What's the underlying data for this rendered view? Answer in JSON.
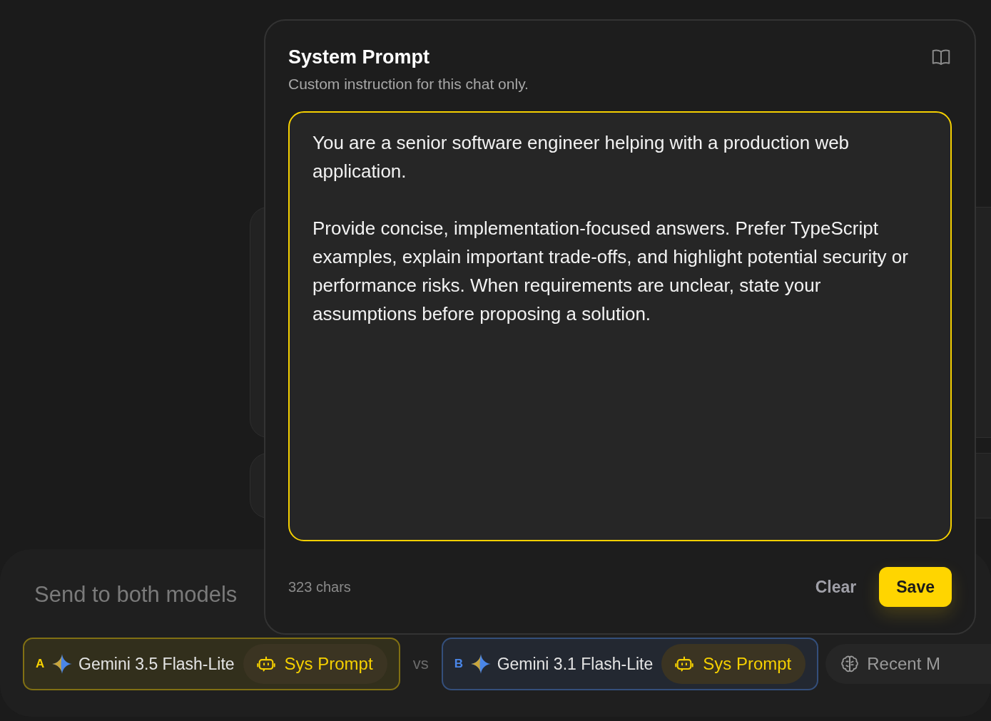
{
  "modal": {
    "title": "System Prompt",
    "subtitle": "Custom instruction for this chat only.",
    "prompt": "You are a senior software engineer helping with a production web application.\n\nProvide concise, implementation-focused answers. Prefer TypeScript examples, explain important trade-offs, and highlight potential security or performance risks. When requirements are unclear, state your assumptions before proposing a solution.",
    "char_count": "323 chars",
    "buttons": [
      {
        "label": "Clear",
        "kind": "secondary"
      },
      {
        "label": "Save",
        "kind": "primary"
      }
    ]
  },
  "composer": {
    "placeholder": "Send to both models",
    "separator": "vs",
    "models": [
      {
        "letter": "A",
        "name": "Gemini 3.5 Flash-Lite",
        "color": "#f5d000",
        "button": "Sys Prompt"
      },
      {
        "letter": "B",
        "name": "Gemini 3.1 Flash-Lite",
        "color": "#4a86e8",
        "button": "Sys Prompt"
      }
    ],
    "memory_button": "Recent M"
  }
}
